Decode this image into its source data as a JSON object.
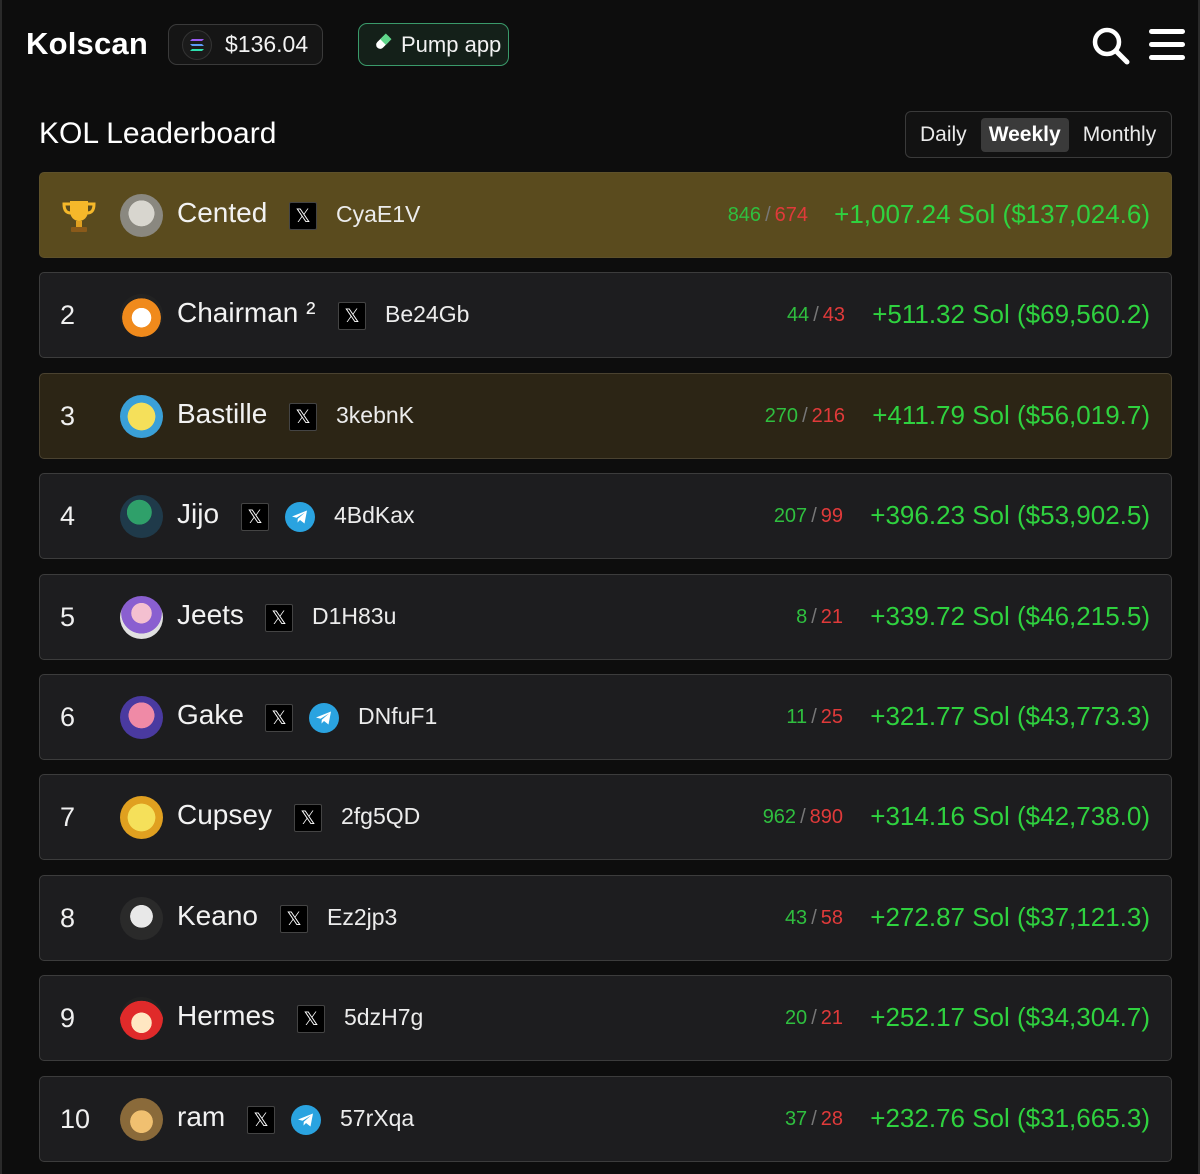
{
  "header": {
    "brand": "Kolscan",
    "sol_price": "$136.04",
    "pump_app_label": "Pump app",
    "icons": [
      "solana-icon",
      "pill-icon",
      "search-icon",
      "menu-icon"
    ]
  },
  "leaderboard": {
    "title": "KOL Leaderboard",
    "periods": [
      "Daily",
      "Weekly",
      "Monthly"
    ],
    "active_period": "Weekly",
    "rows": [
      {
        "rank": "1",
        "name": "Cented",
        "has_telegram": false,
        "wallet": "CyaE1V",
        "wins": "846",
        "losses": "674",
        "pnl": "+1,007.24 Sol ($137,024.6)"
      },
      {
        "rank": "2",
        "name": "Chairman ²",
        "has_telegram": false,
        "wallet": "Be24Gb",
        "wins": "44",
        "losses": "43",
        "pnl": "+511.32 Sol ($69,560.2)"
      },
      {
        "rank": "3",
        "name": "Bastille",
        "has_telegram": false,
        "wallet": "3kebnK",
        "wins": "270",
        "losses": "216",
        "pnl": "+411.79 Sol ($56,019.7)"
      },
      {
        "rank": "4",
        "name": "Jijo",
        "has_telegram": true,
        "wallet": "4BdKax",
        "wins": "207",
        "losses": "99",
        "pnl": "+396.23 Sol ($53,902.5)"
      },
      {
        "rank": "5",
        "name": "Jeets",
        "has_telegram": false,
        "wallet": "D1H83u",
        "wins": "8",
        "losses": "21",
        "pnl": "+339.72 Sol ($46,215.5)"
      },
      {
        "rank": "6",
        "name": "Gake",
        "has_telegram": true,
        "wallet": "DNfuF1",
        "wins": "11",
        "losses": "25",
        "pnl": "+321.77 Sol ($43,773.3)"
      },
      {
        "rank": "7",
        "name": "Cupsey",
        "has_telegram": false,
        "wallet": "2fg5QD",
        "wins": "962",
        "losses": "890",
        "pnl": "+314.16 Sol ($42,738.0)"
      },
      {
        "rank": "8",
        "name": "Keano",
        "has_telegram": false,
        "wallet": "Ez2jp3",
        "wins": "43",
        "losses": "58",
        "pnl": "+272.87 Sol ($37,121.3)"
      },
      {
        "rank": "9",
        "name": "Hermes",
        "has_telegram": false,
        "wallet": "5dzH7g",
        "wins": "20",
        "losses": "21",
        "pnl": "+252.17 Sol ($34,304.7)"
      },
      {
        "rank": "10",
        "name": "ram",
        "has_telegram": true,
        "wallet": "57rXqa",
        "wins": "37",
        "losses": "28",
        "pnl": "+232.76 Sol ($31,665.3)"
      }
    ]
  },
  "colors": {
    "background": "#0d0d0d",
    "row": "#1d1d1f",
    "gold_row": "#5a4b1e",
    "bronze_row": "#2c2515",
    "win_green": "#2fbf3f",
    "loss_red": "#e03a3a",
    "pnl_green": "#2fd23f"
  }
}
